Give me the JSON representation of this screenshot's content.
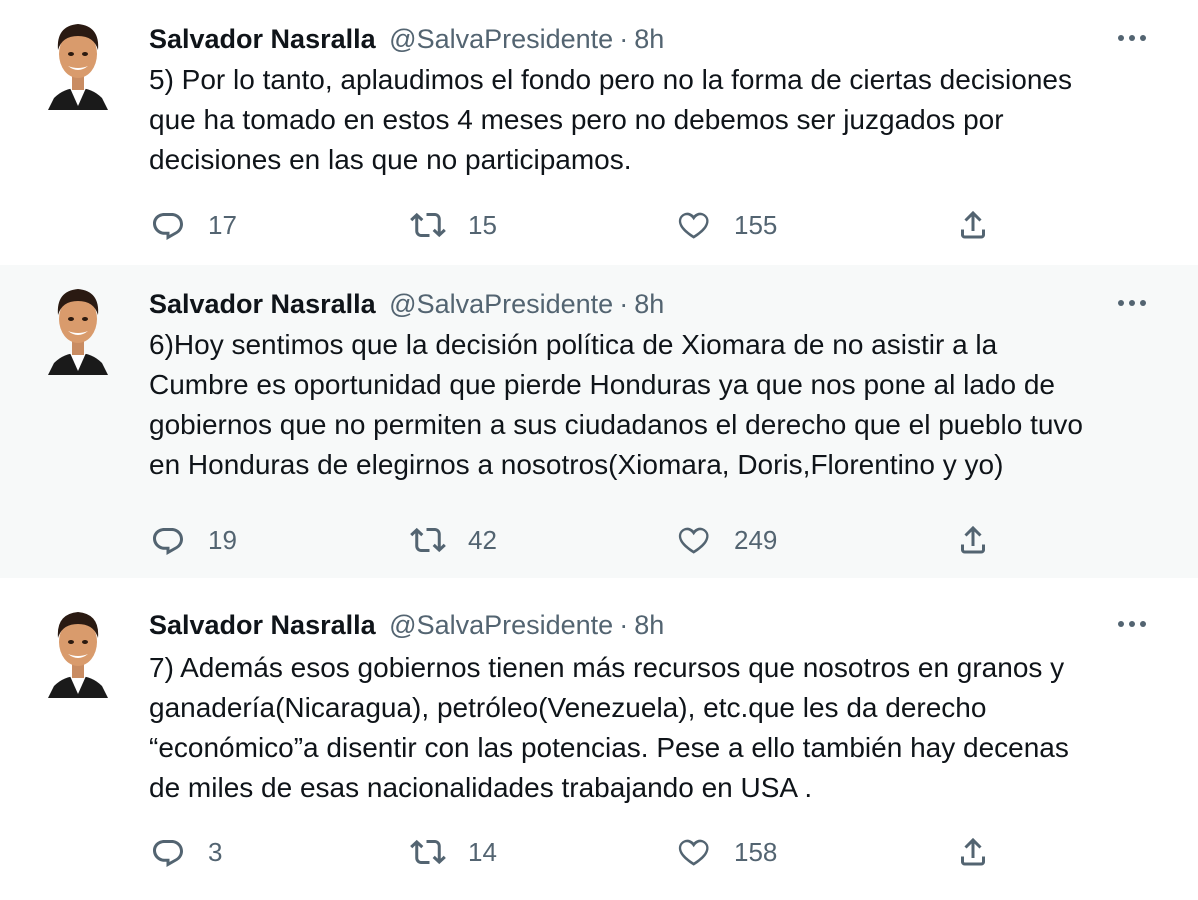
{
  "tweets": [
    {
      "name": "Salvador Nasralla",
      "handle": "@SalvaPresidente",
      "separator": "·",
      "time": "8h",
      "text": "5) Por lo tanto, aplaudimos el fondo pero no la forma de ciertas decisiones\nque ha tomado en estos 4 meses pero no debemos ser juzgados por\ndecisiones en las que no participamos.",
      "replies": "17",
      "retweets": "15",
      "likes": "155"
    },
    {
      "name": "Salvador Nasralla",
      "handle": "@SalvaPresidente",
      "separator": "·",
      "time": "8h",
      "text": "6)Hoy sentimos que la decisión política de Xiomara de no asistir a la\nCumbre es  oportunidad que pierde Honduras ya que nos pone al lado de\ngobiernos que no permiten a sus ciudadanos el derecho que el pueblo tuvo\nen Honduras de elegirnos a nosotros(Xiomara, Doris,Florentino y yo)",
      "replies": "19",
      "retweets": "42",
      "likes": "249"
    },
    {
      "name": "Salvador Nasralla",
      "handle": "@SalvaPresidente",
      "separator": "·",
      "time": "8h",
      "text": "7) Además esos gobiernos tienen más recursos que nosotros en granos y\nganadería(Nicaragua), petróleo(Venezuela), etc.que les da derecho\n“económico”a disentir con las potencias. Pese a ello también hay decenas\nde miles de esas nacionalidades trabajando en USA .",
      "replies": "3",
      "retweets": "14",
      "likes": "158"
    }
  ],
  "icons": {
    "reply": "reply-icon",
    "retweet": "retweet-icon",
    "like": "heart-icon",
    "share": "share-icon",
    "more": "more-icon"
  },
  "colors": {
    "text": "#0f1419",
    "secondary": "#536471",
    "thread_line": "#cfd9de",
    "hover_background": "#f7f9f9"
  }
}
